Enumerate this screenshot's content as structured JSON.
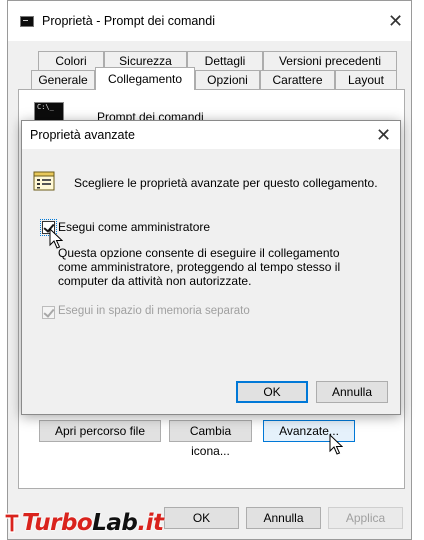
{
  "window": {
    "title": "Proprietà - Prompt dei comandi",
    "close_glyph": "✕",
    "tabs_row1": [
      "Colori",
      "Sicurezza",
      "Dettagli",
      "Versioni precedenti"
    ],
    "tabs_row2": [
      "Generale",
      "Collegamento",
      "Opzioni",
      "Carattere",
      "Layout"
    ],
    "active_tab": "Collegamento",
    "shortcut_name": "Prompt dei comandi",
    "cmd_icon_text": "C:\\_",
    "pane_buttons": [
      "Apri percorso file",
      "Cambia icona...",
      "Avanzate..."
    ],
    "footer_buttons": {
      "ok": "OK",
      "cancel": "Annulla",
      "apply": "Applica"
    }
  },
  "dialog": {
    "title": "Proprietà avanzate",
    "close_glyph": "✕",
    "intro": "Scegliere le proprietà avanzate per questo collegamento.",
    "run_as_admin": {
      "label": "Esegui come amministratore",
      "checked": true,
      "description": "Questa opzione consente di eseguire il collegamento come amministratore, proteggendo al tempo stesso il computer da attività non autorizzate."
    },
    "separate_memory": {
      "label": "Esegui in spazio di memoria separato",
      "checked": true,
      "enabled": false
    },
    "ok_label": "OK",
    "cancel_label": "Annulla"
  },
  "watermark": {
    "text_part1": "Turbo",
    "text_part2": "Lab",
    "text_part3": ".it",
    "color_main": "#d9231d"
  },
  "colors": {
    "accent": "#0078d7",
    "window_bg": "#f0f0f0",
    "disabled_text": "#a0a0a0"
  }
}
